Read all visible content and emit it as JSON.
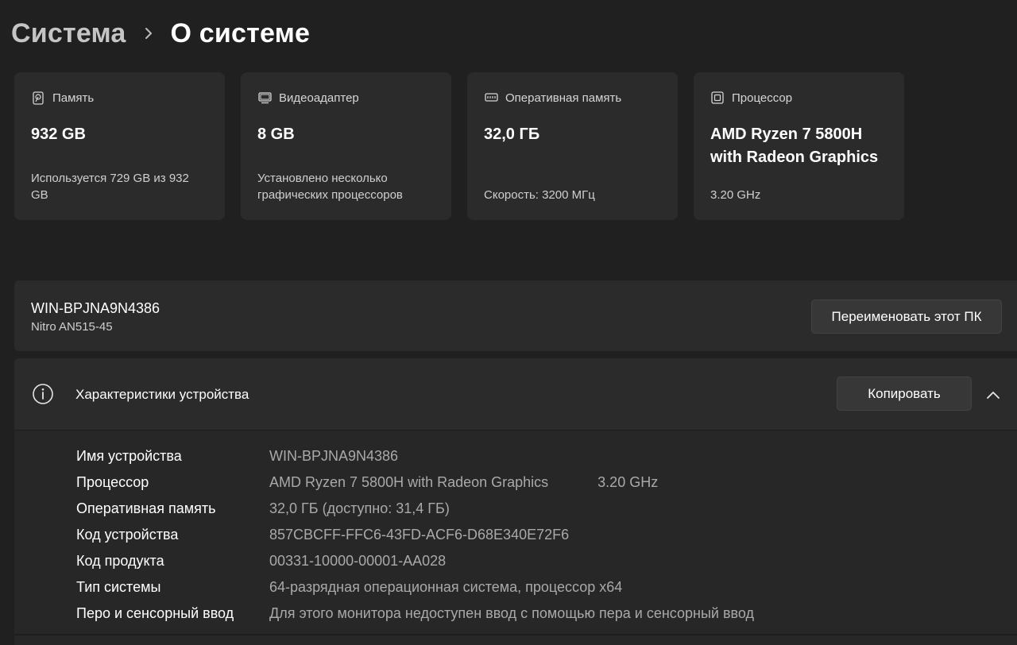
{
  "breadcrumb": {
    "parent": "Система",
    "current": "О системе"
  },
  "cards": [
    {
      "icon": "hard-drive-icon",
      "label": "Память",
      "value": "932 GB",
      "sub": "Используется 729 GB из 932 GB"
    },
    {
      "icon": "monitor-icon",
      "label": "Видеоадаптер",
      "value": "8 GB",
      "sub": "Установлено несколько графических процессоров"
    },
    {
      "icon": "memory-icon",
      "label": "Оперативная память",
      "value": "32,0 ГБ",
      "sub": "Скорость: 3200 МГц"
    },
    {
      "icon": "cpu-icon",
      "label": "Процессор",
      "value": "AMD Ryzen 7 5800H with Radeon Graphics",
      "sub": "3.20 GHz"
    }
  ],
  "device": {
    "name": "WIN-BPJNA9N4386",
    "model": "Nitro AN515-45",
    "rename_label": "Переименовать этот ПК"
  },
  "specs": {
    "title": "Характеристики устройства",
    "copy_label": "Копировать",
    "rows": [
      {
        "key": "Имя устройства",
        "value": "WIN-BPJNA9N4386",
        "extra": ""
      },
      {
        "key": "Процессор",
        "value": "AMD Ryzen 7 5800H with Radeon Graphics",
        "extra": "3.20 GHz"
      },
      {
        "key": "Оперативная память",
        "value": "32,0 ГБ (доступно: 31,4 ГБ)",
        "extra": ""
      },
      {
        "key": "Код устройства",
        "value": "857CBCFF-FFC6-43FD-ACF6-D68E340E72F6",
        "extra": ""
      },
      {
        "key": "Код продукта",
        "value": "00331-10000-00001-AA028",
        "extra": ""
      },
      {
        "key": "Тип системы",
        "value": "64-разрядная операционная система, процессор x64",
        "extra": ""
      },
      {
        "key": "Перо и сенсорный ввод",
        "value": "Для этого монитора недоступен ввод с помощью пера и сенсорный ввод",
        "extra": ""
      }
    ]
  }
}
